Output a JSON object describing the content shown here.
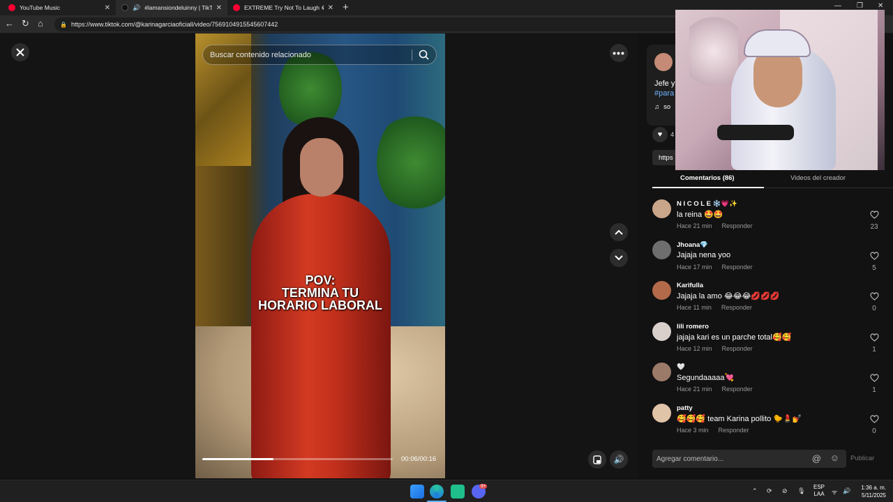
{
  "browser": {
    "tabs": [
      {
        "title": "YouTube Music",
        "icon": "youtube-music-icon",
        "color": "#ff0033"
      },
      {
        "title": "#lamansiondeluinny | TikTok",
        "icon": "tiktok-icon",
        "color": "#111111"
      },
      {
        "title": "EXTREME Try Not To Laugh 😂 #",
        "icon": "youtube-icon",
        "color": "#ff0033"
      }
    ],
    "url": "https://www.tiktok.com/@karinagarciaoficiall/video/7569104915545607442"
  },
  "video": {
    "search_placeholder": "Buscar contenido relacionado",
    "overlay_lines": [
      "POV:",
      "TERMINA TU",
      "HORARIO LABORAL"
    ],
    "time": "00:06/00:16",
    "progress": 0.375
  },
  "post": {
    "caption_line": "Jefe y",
    "hashtag": "#para",
    "sound": "so",
    "likes": "4",
    "link_chip": "https"
  },
  "panel": {
    "tabs": {
      "comments": "Comentarios (86)",
      "creator": "Videos del creador"
    },
    "reply_label": "Responder",
    "comment_placeholder": "Agregar comentario...",
    "publish_label": "Publicar"
  },
  "comments": [
    {
      "user": "N I C O L E ❄️💗✨",
      "text": "la reina 🤩🤩",
      "time": "Hace 21 min",
      "likes": "23",
      "avatar_color": "#c9a58a"
    },
    {
      "user": "Jhoana💎",
      "text": "Jajaja nena yoo",
      "time": "Hace 17 min",
      "likes": "5",
      "avatar_color": "#6e6e6e"
    },
    {
      "user": "Karifulla",
      "text": "Jajaja la amo 😂😂😂💋💋💋",
      "time": "Hace 11 min",
      "likes": "0",
      "avatar_color": "#b36a4a"
    },
    {
      "user": "lili romero",
      "text": "jajaja kari es un parche total🥰🥰",
      "time": "Hace 12 min",
      "likes": "1",
      "avatar_color": "#d9d0cc"
    },
    {
      "user": "🤍",
      "text": "Segundaaaaa💘",
      "time": "Hace 21 min",
      "likes": "1",
      "avatar_color": "#9b7a6a"
    },
    {
      "user": "patty",
      "text": "🥰🥰🥰 team Karina pollito 🐤💄💅",
      "time": "Hace 3 min",
      "likes": "0",
      "avatar_color": "#e0c4a8"
    }
  ],
  "taskbar": {
    "lang": [
      "ESP",
      "LAA"
    ],
    "time": "1:36 a. m.",
    "date": "5/11/2025",
    "discord_badge": "9+"
  }
}
